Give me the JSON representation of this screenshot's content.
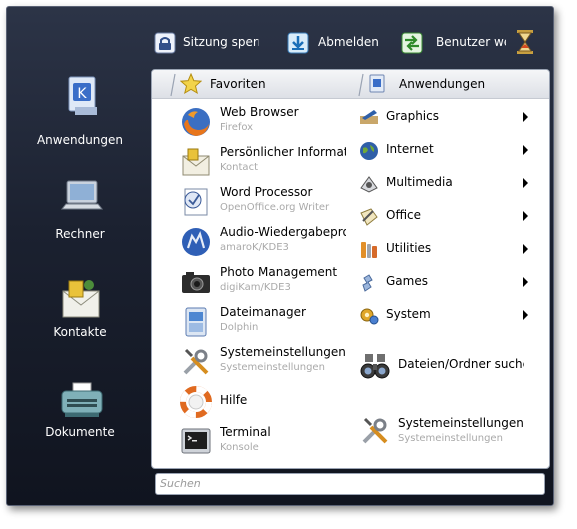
{
  "topbar": {
    "lock_label": "Sitzung sperren",
    "logout_label": "Abmelden",
    "switch_user_label": "Benutzer wechseln"
  },
  "sidebar": {
    "items": [
      {
        "label": "Anwendungen",
        "icon": "applications-icon"
      },
      {
        "label": "Rechner",
        "icon": "laptop-icon"
      },
      {
        "label": "Kontakte",
        "icon": "contacts-icon"
      },
      {
        "label": "Dokumente",
        "icon": "typewriter-icon"
      }
    ]
  },
  "panel": {
    "favorites_title": "Favoriten",
    "applications_title": "Anwendungen",
    "favorites": [
      {
        "name": "Web Browser",
        "desc": "Firefox",
        "icon": "firefox-icon"
      },
      {
        "name": "Persönlicher Informationsmanager",
        "desc": "Kontact",
        "icon": "kontact-icon"
      },
      {
        "name": "Word Processor",
        "desc": "OpenOffice.org Writer",
        "icon": "writer-icon"
      },
      {
        "name": "Audio-Wiedergabeprogramm",
        "desc": "amaroK/KDE3",
        "icon": "amarok-icon"
      },
      {
        "name": "Photo Management",
        "desc": "digiKam/KDE3",
        "icon": "camera-icon"
      },
      {
        "name": "Dateimanager",
        "desc": "Dolphin",
        "icon": "dolphin-icon"
      },
      {
        "name": "Systemeinstellungen",
        "desc": "Systemeinstellungen",
        "icon": "tools-icon"
      },
      {
        "name": "Hilfe",
        "desc": "",
        "icon": "help-icon"
      },
      {
        "name": "Terminal",
        "desc": "Konsole",
        "icon": "terminal-icon"
      }
    ],
    "categories": [
      {
        "label": "Graphics",
        "icon": "graphics-icon"
      },
      {
        "label": "Internet",
        "icon": "globe-icon"
      },
      {
        "label": "Multimedia",
        "icon": "multimedia-icon"
      },
      {
        "label": "Office",
        "icon": "office-icon"
      },
      {
        "label": "Utilities",
        "icon": "utilities-icon"
      },
      {
        "label": "Games",
        "icon": "games-icon"
      },
      {
        "label": "System",
        "icon": "system-icon"
      }
    ],
    "find_files_label": "Dateien/Ordner suchen",
    "settings_label": "Systemeinstellungen",
    "settings_desc": "Systemeinstellungen"
  },
  "search": {
    "placeholder": "Suchen",
    "value": ""
  },
  "colors": {
    "menu_background": "#1b2130",
    "panel_background": "#ffffff",
    "secondary_text": "#a9a9a9"
  }
}
